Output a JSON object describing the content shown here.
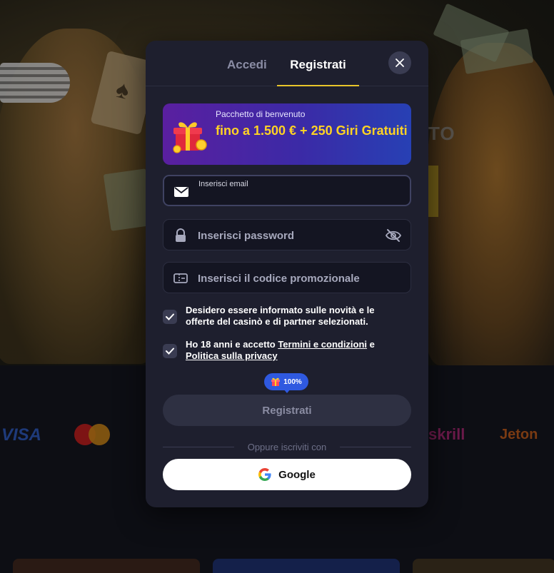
{
  "tabs": {
    "login": "Accedi",
    "register": "Registrati",
    "active": "register"
  },
  "banner": {
    "small": "Pacchetto di benvenuto",
    "big": "fino a 1.500 € + 250 Giri Gratuiti"
  },
  "form": {
    "email_label": "Inserisci email",
    "email_value": "",
    "password_placeholder": "Inserisci password",
    "promo_placeholder": "Inserisci il codice promozionale"
  },
  "checkboxes": {
    "newsletter": {
      "checked": true,
      "text": "Desidero essere informato sulle novità e le offerte del casinò e di partner selezionati."
    },
    "terms": {
      "checked": true,
      "prefix": "Ho 18 anni e accetto ",
      "terms_link": "Termini e condizioni",
      "middle": " e ",
      "privacy_link": "Politica sulla privacy"
    }
  },
  "progress": {
    "label": "100%",
    "value": 1.0
  },
  "submit_label": "Registrati",
  "divider_text": "Oppure iscriviti con",
  "google_label": "Google",
  "background": {
    "payments": [
      "VISA",
      "skrill",
      "Jeton"
    ],
    "hero_text": "TO"
  },
  "colors": {
    "modal_bg": "#1e1f2e",
    "accent_underline": "#e8c52a",
    "banner_highlight": "#ffd324",
    "badge_blue": "#2f59e0"
  },
  "icons": {
    "close": "close-icon",
    "email": "envelope-icon",
    "password": "lock-icon",
    "promo": "ticket-icon",
    "visibility": "eye-off-icon",
    "google": "google-logo",
    "gift": "gift-icon"
  }
}
